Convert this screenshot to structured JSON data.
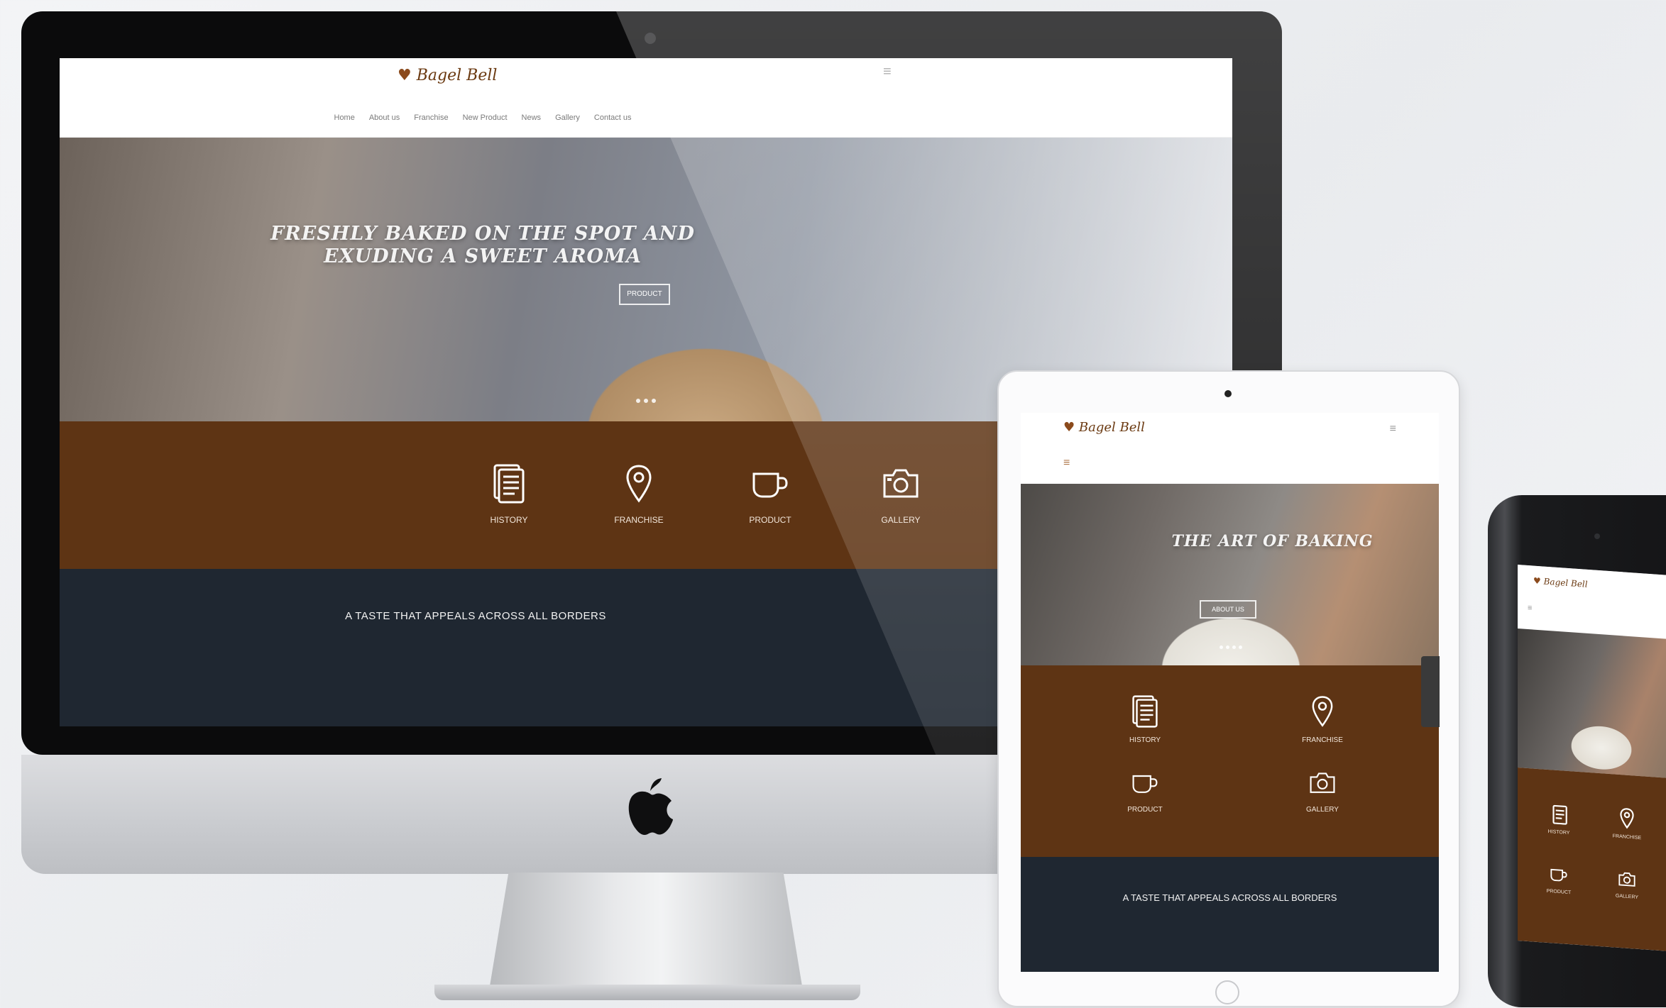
{
  "brand": {
    "logo_text": "Bagel Bell"
  },
  "imac": {
    "nav_items": [
      "Home",
      "About us",
      "Franchise",
      "New Product",
      "News",
      "Gallery",
      "Contact us"
    ],
    "hero": {
      "title_line1": "FRESHLY BAKED ON THE SPOT AND",
      "title_line2": "EXUDING A SWEET AROMA",
      "button_label": "Product"
    },
    "features": [
      {
        "label": "HISTORY",
        "icon": "document-icon"
      },
      {
        "label": "FRANCHISE",
        "icon": "map-pin-icon"
      },
      {
        "label": "PRODUCT",
        "icon": "cup-icon"
      },
      {
        "label": "GALLERY",
        "icon": "camera-icon"
      }
    ],
    "tagline": "A TASTE THAT APPEALS ACROSS ALL BORDERS"
  },
  "ipad": {
    "hero": {
      "title": "THE ART OF BAKING",
      "button_label": "About us"
    },
    "features": [
      {
        "label": "HISTORY",
        "icon": "document-icon"
      },
      {
        "label": "FRANCHISE",
        "icon": "map-pin-icon"
      },
      {
        "label": "PRODUCT",
        "icon": "cup-icon"
      },
      {
        "label": "GALLERY",
        "icon": "camera-icon"
      }
    ],
    "tagline": "A TASTE THAT APPEALS ACROSS ALL BORDERS"
  },
  "iphone": {
    "features": [
      {
        "label": "HISTORY",
        "icon": "document-icon"
      },
      {
        "label": "FRANCHISE",
        "icon": "map-pin-icon"
      },
      {
        "label": "PRODUCT",
        "icon": "cup-icon"
      },
      {
        "label": "GALLERY",
        "icon": "camera-icon"
      }
    ]
  },
  "colors": {
    "brown_band": "#5e3414",
    "dark_band": "#1f2731",
    "logo": "#6b3a12"
  }
}
